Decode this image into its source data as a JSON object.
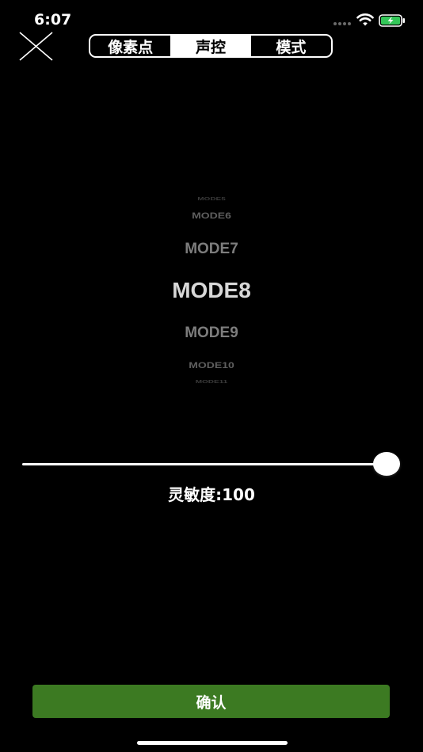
{
  "status_bar": {
    "time": "6:07",
    "icons": [
      "signal-dots-icon",
      "wifi-icon",
      "battery-charging-icon"
    ],
    "battery_color": "#34c759"
  },
  "header": {
    "close_icon": "close-icon",
    "tabs": [
      {
        "label": "像素点",
        "active": false
      },
      {
        "label": "声控",
        "active": true
      },
      {
        "label": "模式",
        "active": false
      }
    ]
  },
  "picker": {
    "items": [
      "MODE5",
      "MODE6",
      "MODE7",
      "MODE8",
      "MODE9",
      "MODE10",
      "MODE11"
    ],
    "selected": "MODE8"
  },
  "slider": {
    "value": 100,
    "max": 100,
    "label": "灵敏度:100"
  },
  "footer": {
    "confirm_label": "确认",
    "accent_color": "#3c7a22"
  }
}
